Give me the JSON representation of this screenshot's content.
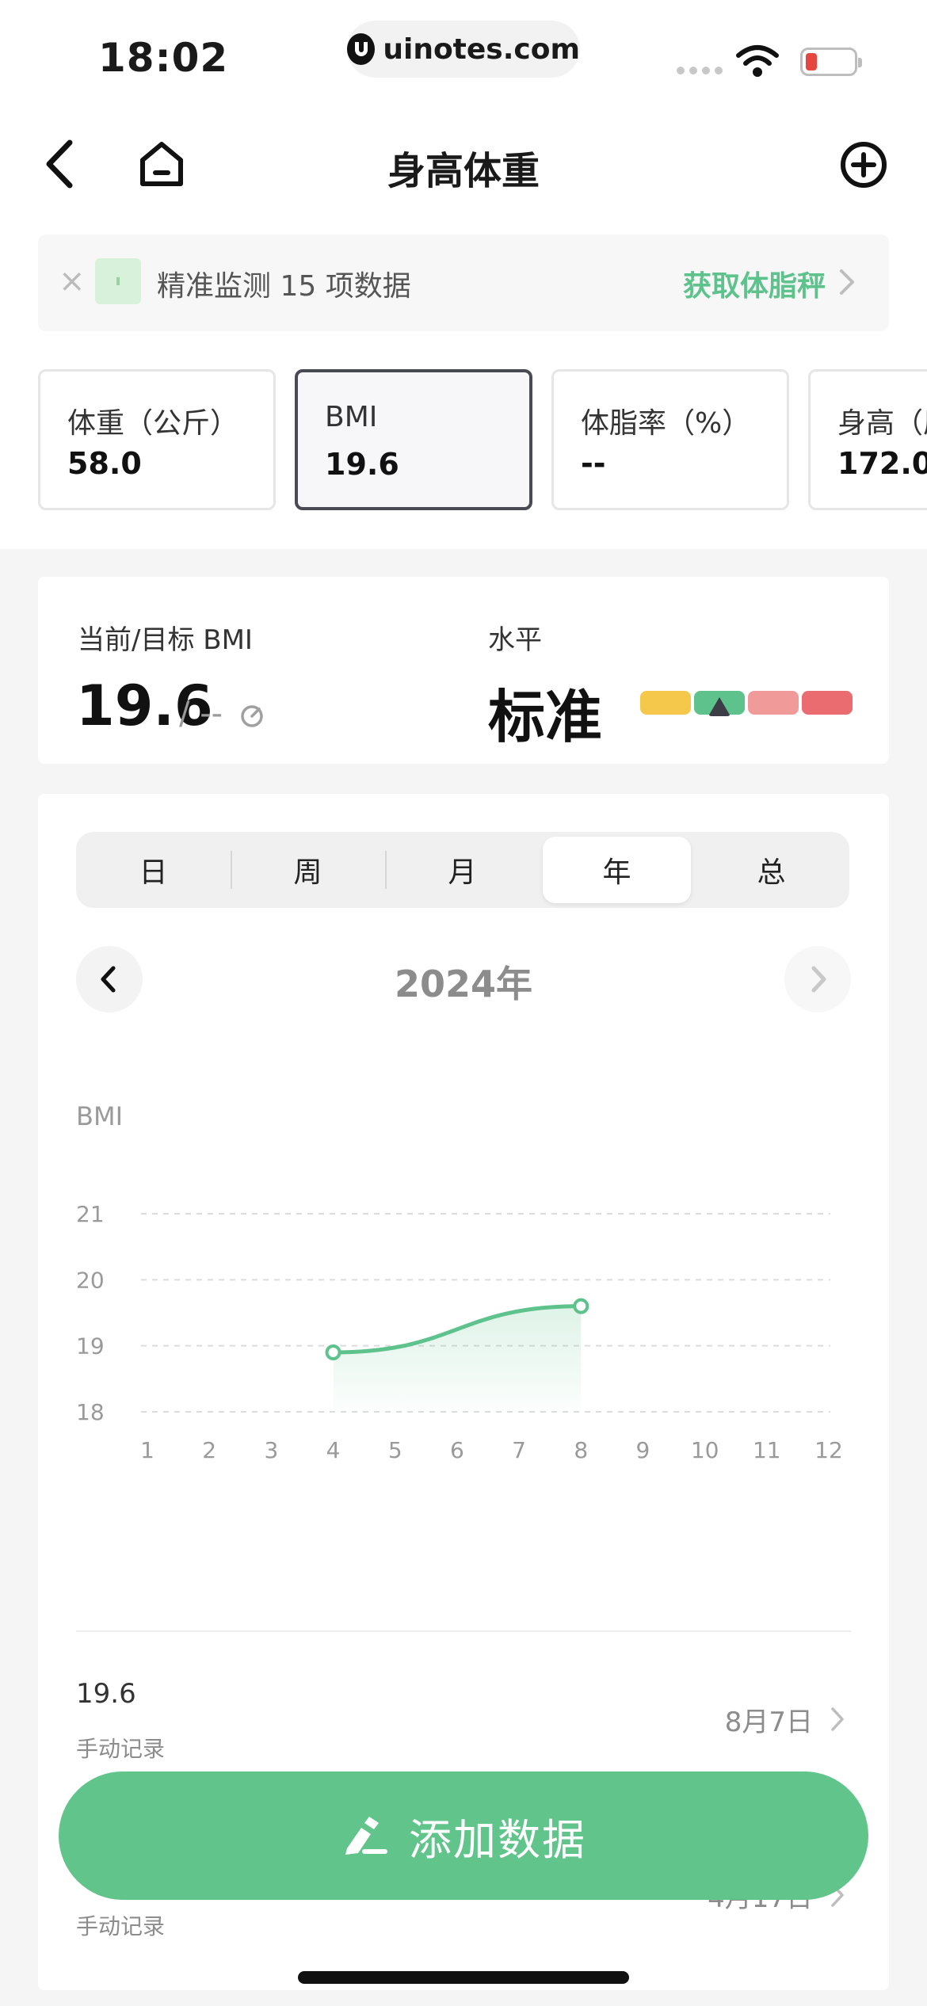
{
  "status_bar": {
    "time": "18:02",
    "url": "uinotes.com",
    "battery_color": "#e5463f"
  },
  "nav": {
    "back_icon": "chevron-left-icon",
    "home_icon": "home-icon",
    "title": "身高体重",
    "add_icon": "plus-circle-icon"
  },
  "banner": {
    "close": "×",
    "text": "精准监测 15 项数据",
    "link": "获取体脂秤",
    "link_color": "#5dc28b"
  },
  "metrics": [
    {
      "label": "体重（公斤）",
      "value": "58.0",
      "selected": false
    },
    {
      "label": "BMI",
      "value": "19.6",
      "selected": true
    },
    {
      "label": "体脂率（%）",
      "value": "--",
      "selected": false
    },
    {
      "label": "身高（厘",
      "value": "172.0",
      "selected": false
    }
  ],
  "summary": {
    "label": "当前/目标 BMI",
    "current": "19.6",
    "target": "/ --",
    "level_label": "水平",
    "level": "标准",
    "level_colors": [
      "#f5c84c",
      "#5dc28b",
      "#f09a9a",
      "#ea6b70"
    ],
    "level_index": 1
  },
  "period_tabs": [
    "日",
    "周",
    "月",
    "年",
    "总"
  ],
  "active_tab_index": 3,
  "period_label": "2024年",
  "chart_data": {
    "type": "line",
    "ylabel": "BMI",
    "ylim": [
      18,
      21
    ],
    "yticks": [
      "18",
      "19",
      "20",
      "21"
    ],
    "xticks": [
      "1",
      "2",
      "3",
      "4",
      "5",
      "6",
      "7",
      "8",
      "9",
      "10",
      "11",
      "12"
    ],
    "series": [
      {
        "x": [
          4,
          8
        ],
        "values": [
          18.9,
          19.6
        ]
      }
    ],
    "line_color": "#5dc28b",
    "grid": "dashed"
  },
  "records": [
    {
      "value": "19.6",
      "source": "手动记录",
      "date": "8月7日"
    },
    {
      "value": "",
      "source": "手动记录",
      "date": "4月17日"
    }
  ],
  "add_button": {
    "label": "添加数据",
    "icon": "edit-pen-icon",
    "color": "#60c48b"
  }
}
